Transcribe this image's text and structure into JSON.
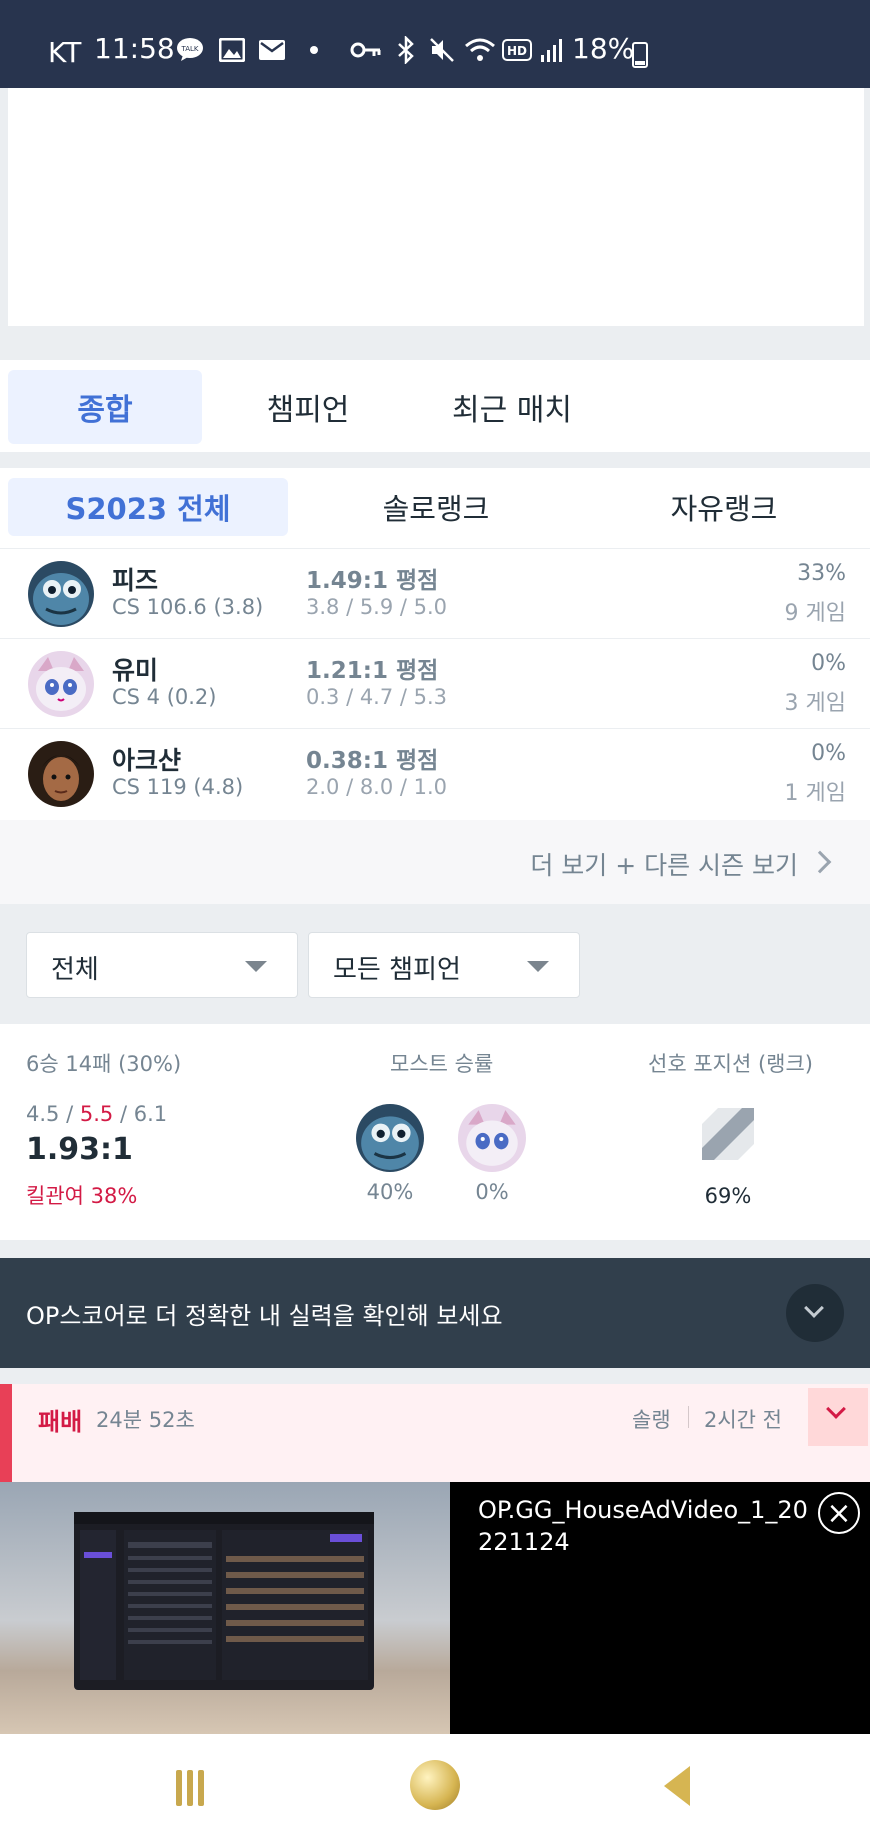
{
  "status_bar": {
    "carrier": "KT",
    "time": "11:58",
    "battery": "18%",
    "icons": [
      "talk-icon",
      "image-icon",
      "mail-icon",
      "dot-icon",
      "key-icon",
      "bluetooth-icon",
      "mute-icon",
      "wifi-icon",
      "hd-icon",
      "signal-icon",
      "battery-icon"
    ]
  },
  "main_tabs": [
    {
      "label": "종합",
      "active": true
    },
    {
      "label": "챔피언",
      "active": false
    },
    {
      "label": "최근 매치",
      "active": false
    }
  ],
  "season_tabs": [
    {
      "label": "S2023 전체",
      "active": true
    },
    {
      "label": "솔로랭크",
      "active": false
    },
    {
      "label": "자유랭크",
      "active": false
    }
  ],
  "champions": [
    {
      "name": "피즈",
      "cs": "CS 106.6 (3.8)",
      "kda": "1.49:1 평점",
      "kda_detail": "3.8 / 5.9 / 5.0",
      "winrate": "33%",
      "games": "9 게임"
    },
    {
      "name": "유미",
      "cs": "CS 4 (0.2)",
      "kda": "1.21:1 평점",
      "kda_detail": "0.3 / 4.7 / 5.3",
      "winrate": "0%",
      "games": "3 게임"
    },
    {
      "name": "아크샨",
      "cs": "CS 119 (4.8)",
      "kda": "0.38:1 평점",
      "kda_detail": "2.0 / 8.0 / 1.0",
      "winrate": "0%",
      "games": "1 게임"
    }
  ],
  "more_link": "더 보기 + 다른 시즌 보기",
  "filters": {
    "queue": "전체",
    "champion": "모든 챔피언"
  },
  "summary": {
    "record": "6승 14패 (30%)",
    "kills": "4.5",
    "deaths": "5.5",
    "assists": "6.1",
    "slash": "/",
    "kda_ratio": "1.93:1",
    "kill_participation": "킬관여 38%",
    "most_label": "모스트 승률",
    "most": [
      {
        "champion": "피즈",
        "pct": "40%"
      },
      {
        "champion": "유미",
        "pct": "0%"
      }
    ],
    "position_label": "선호 포지션 (랭크)",
    "position_pct": "69%"
  },
  "op_banner": "OP스코어로 더 정확한 내 실력을 확인해 보세요",
  "match": {
    "result": "패배",
    "duration": "24분 52초",
    "queue": "솔랭",
    "ago": "2시간 전"
  },
  "video_ad": {
    "title": "OP.GG_HouseAdVideo_1_20221124"
  },
  "colors": {
    "accent": "#4171d6",
    "loss": "#d31a45",
    "status_bg": "#28344e",
    "banner_bg": "#313f4c"
  }
}
